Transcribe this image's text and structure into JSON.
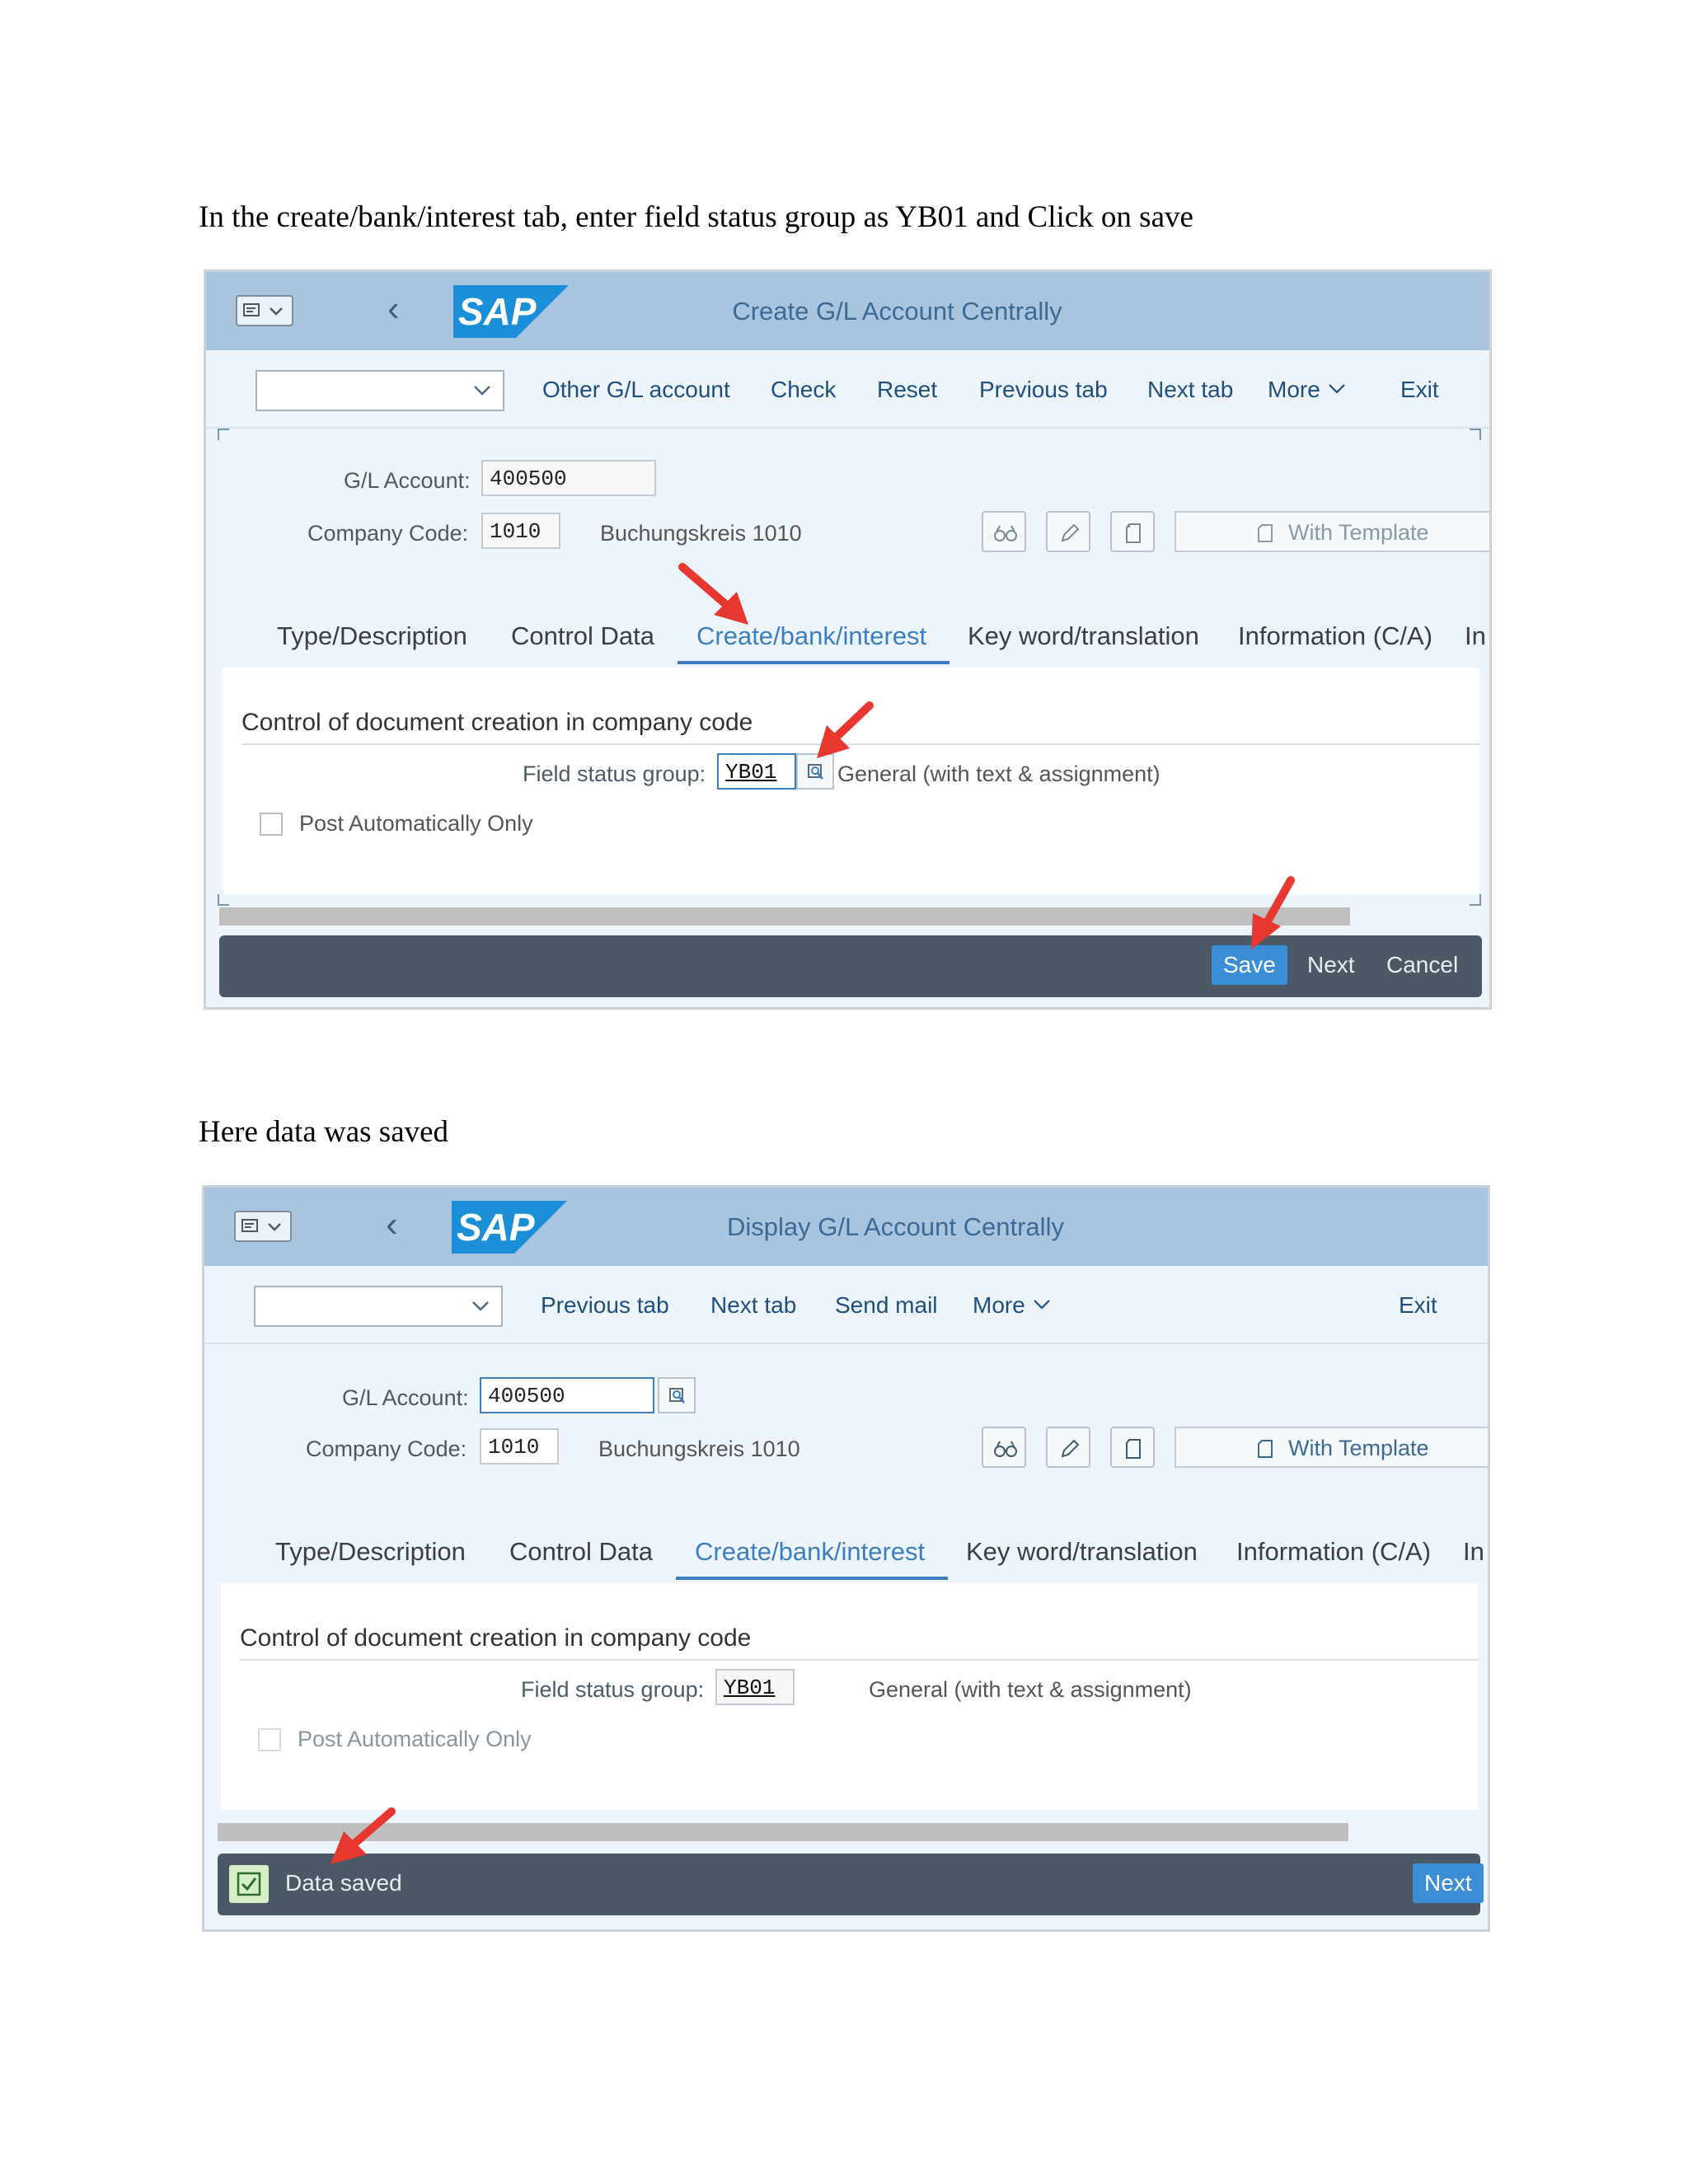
{
  "step1": {
    "caption": "In the create/bank/interest tab, enter field status group as YB01 and Click on save",
    "screen": {
      "title": "Create G/L Account Centrally",
      "logo_text": "SAP",
      "toolbar": [
        "Other G/L account",
        "Check",
        "Reset",
        "Previous tab",
        "Next tab",
        "More",
        "Exit"
      ],
      "gl_account_label": "G/L Account:",
      "gl_account_value": "400500",
      "company_code_label": "Company Code:",
      "company_code_value": "1010",
      "company_name": "Buchungskreis 1010",
      "with_template": "With Template",
      "tabs": [
        "Type/Description",
        "Control Data",
        "Create/bank/interest",
        "Key word/translation",
        "Information (C/A)",
        "In"
      ],
      "active_tab": "Create/bank/interest",
      "section_title": "Control of document creation in company code",
      "field_status_label": "Field status group:",
      "field_status_value": "YB01",
      "field_status_text": "General (with text & assignment)",
      "post_auto_label": "Post Automatically Only",
      "footer": {
        "save": "Save",
        "next": "Next",
        "cancel": "Cancel"
      }
    }
  },
  "step2": {
    "caption": "Here data was saved",
    "screen": {
      "title": "Display G/L Account Centrally",
      "logo_text": "SAP",
      "toolbar": [
        "Previous tab",
        "Next tab",
        "Send mail",
        "More",
        "Exit"
      ],
      "gl_account_label": "G/L Account:",
      "gl_account_value": "400500",
      "company_code_label": "Company Code:",
      "company_code_value": "1010",
      "company_name": "Buchungskreis 1010",
      "with_template": "With Template",
      "tabs": [
        "Type/Description",
        "Control Data",
        "Create/bank/interest",
        "Key word/translation",
        "Information (C/A)",
        "In"
      ],
      "active_tab": "Create/bank/interest",
      "section_title": "Control of document creation in company code",
      "field_status_label": "Field status group:",
      "field_status_value": "YB01",
      "field_status_text": "General (with text & assignment)",
      "post_auto_label": "Post Automatically Only",
      "footer": {
        "status": "Data saved",
        "next": "Next"
      }
    }
  },
  "colors": {
    "accent": "#3a7fc1",
    "shell": "#a9c4de",
    "footer": "#4b5866",
    "arrow": "#e8372f"
  }
}
